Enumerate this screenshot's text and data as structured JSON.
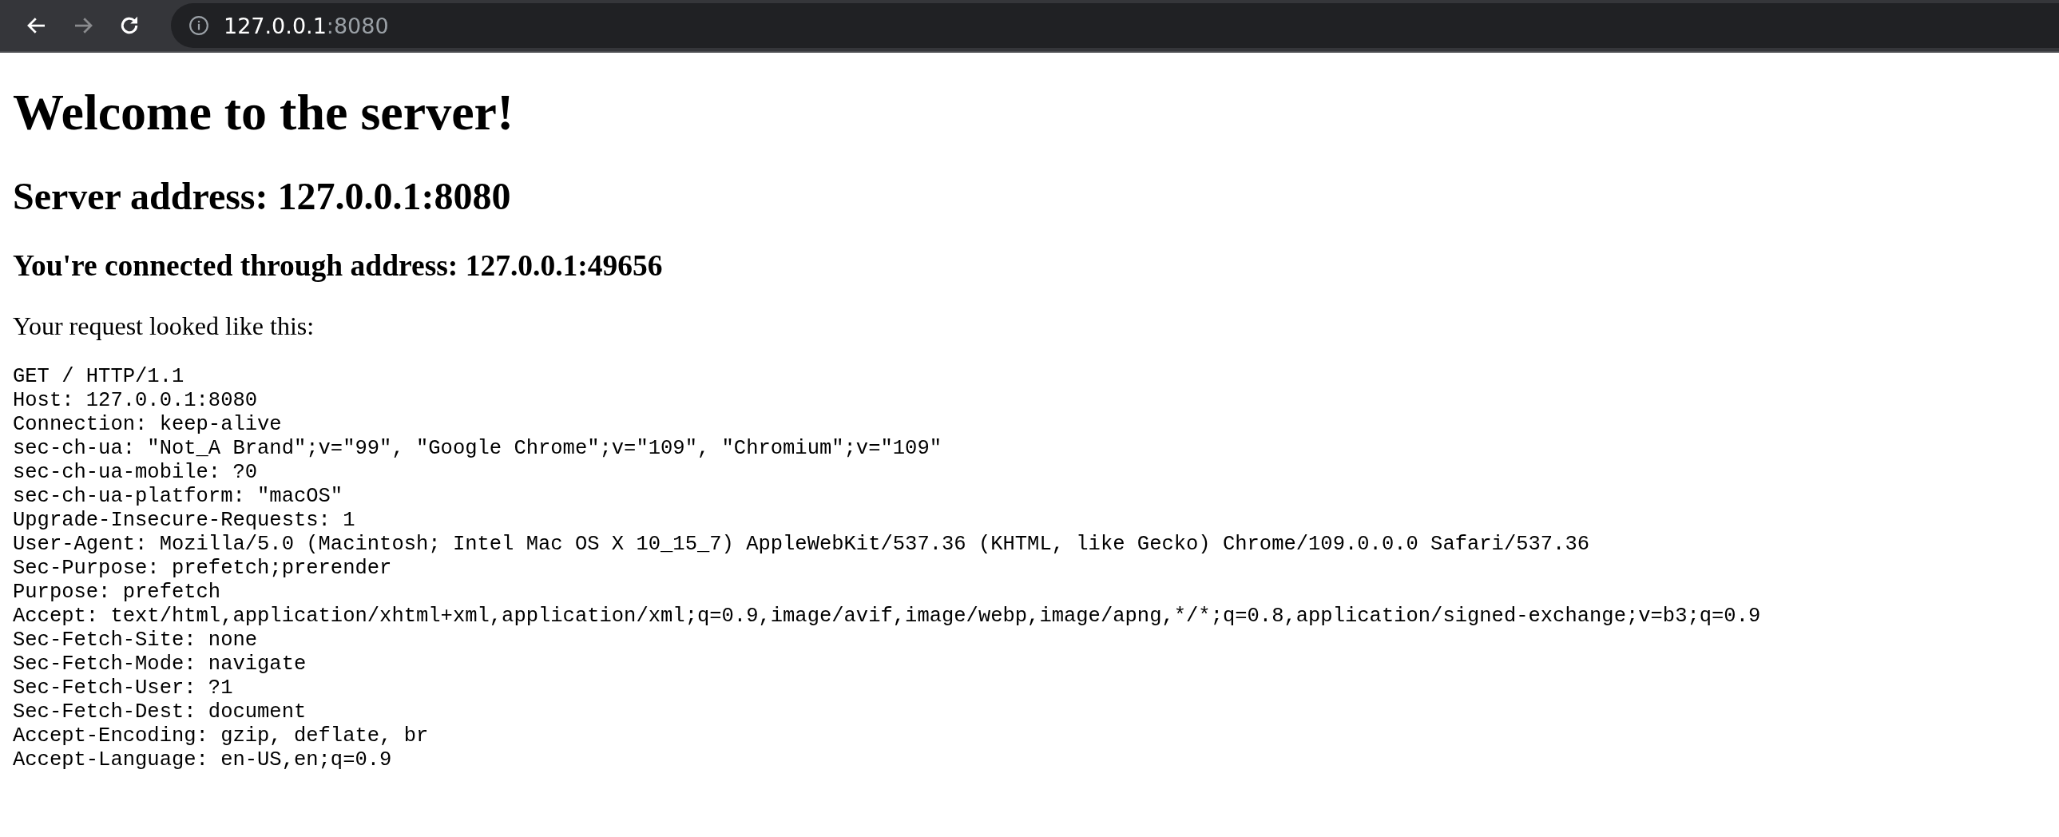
{
  "toolbar": {
    "buttons": [
      {
        "kind": "back",
        "disabled": false
      },
      {
        "kind": "forward",
        "disabled": true
      },
      {
        "kind": "reload",
        "disabled": false
      }
    ],
    "url": {
      "host": "127.0.0.1",
      "port": ":8080"
    }
  },
  "page": {
    "title": "Welcome to the server!",
    "server_address": "Server address: 127.0.0.1:8080",
    "connection": "You're connected through address: 127.0.0.1:49656",
    "intro": "Your request looked like this:",
    "request_lines": [
      "GET / HTTP/1.1",
      "Host: 127.0.0.1:8080",
      "Connection: keep-alive",
      "sec-ch-ua: \"Not_A Brand\";v=\"99\", \"Google Chrome\";v=\"109\", \"Chromium\";v=\"109\"",
      "sec-ch-ua-mobile: ?0",
      "sec-ch-ua-platform: \"macOS\"",
      "Upgrade-Insecure-Requests: 1",
      "User-Agent: Mozilla/5.0 (Macintosh; Intel Mac OS X 10_15_7) AppleWebKit/537.36 (KHTML, like Gecko) Chrome/109.0.0.0 Safari/537.36",
      "Sec-Purpose: prefetch;prerender",
      "Purpose: prefetch",
      "Accept: text/html,application/xhtml+xml,application/xml;q=0.9,image/avif,image/webp,image/apng,*/*;q=0.8,application/signed-exchange;v=b3;q=0.9",
      "Sec-Fetch-Site: none",
      "Sec-Fetch-Mode: navigate",
      "Sec-Fetch-User: ?1",
      "Sec-Fetch-Dest: document",
      "Accept-Encoding: gzip, deflate, br",
      "Accept-Language: en-US,en;q=0.9"
    ]
  }
}
